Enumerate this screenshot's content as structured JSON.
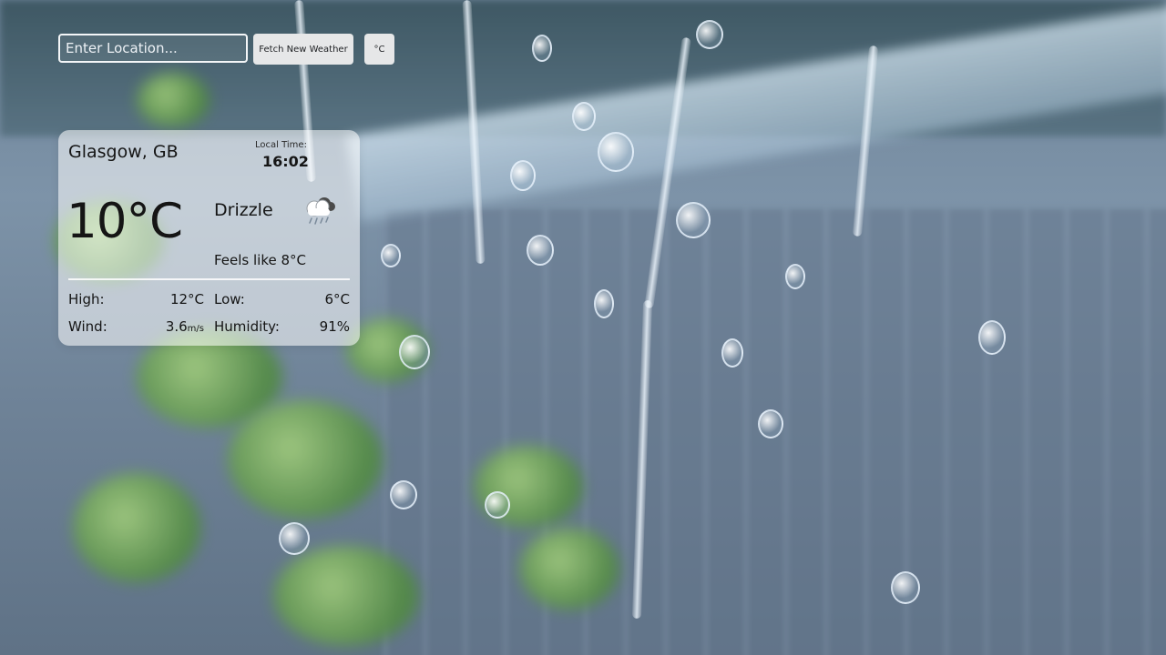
{
  "controls": {
    "location_placeholder": "Enter Location...",
    "fetch_label": "Fetch New Weather",
    "unit_label": "°C"
  },
  "weather": {
    "city": "Glasgow, GB",
    "local_time_label": "Local Time:",
    "local_time": "16:02",
    "temperature": "10°C",
    "condition": "Drizzle",
    "condition_icon": "cloud-rain-icon",
    "feels_like": "Feels like 8°C",
    "high_label": "High:",
    "high_value": "12°C",
    "low_label": "Low:",
    "low_value": "6°C",
    "wind_label": "Wind:",
    "wind_value": "3.6",
    "wind_unit": "m/s",
    "humidity_label": "Humidity:",
    "humidity_value": "91%"
  },
  "colors": {
    "card_background": "#ffffff8c",
    "button_background": "#e6e7e8",
    "text": "#151515"
  }
}
